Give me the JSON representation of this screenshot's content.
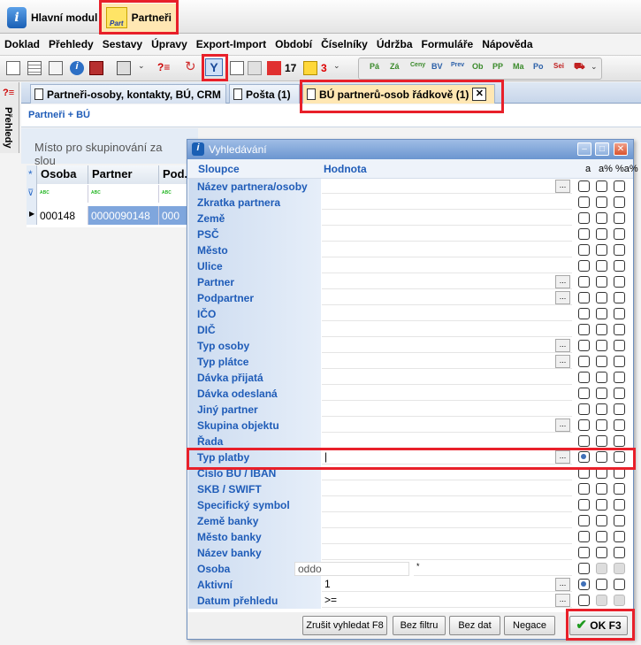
{
  "app_tabs": [
    {
      "label": "Hlavní modul",
      "icon": "info-icon"
    },
    {
      "label": "Partneři",
      "icon": "partner-icon"
    }
  ],
  "menu": [
    "Doklad",
    "Přehledy",
    "Sestavy",
    "Úpravy",
    "Export-Import",
    "Období",
    "Číselníky",
    "Údržba",
    "Formuláře",
    "Nápověda"
  ],
  "toolbar": {
    "count": "17",
    "mail_count": "3"
  },
  "side_panel": {
    "label": "Přehledy"
  },
  "doc_tabs": [
    "Partneři-osoby, kontakty, BÚ, CRM",
    "Pošta (1)",
    "BÚ partnerů-osob řádkově (1)"
  ],
  "breadcrumb": "Partneři + BÚ",
  "grouping_hint": "Místo pro skupinování za slou",
  "grid": {
    "columns": [
      "Osoba",
      "Partner",
      "Pod."
    ],
    "filter_glyph": "ᴀʙᴄ",
    "row": [
      "000148",
      "0000090148",
      "000"
    ]
  },
  "dialog": {
    "title": "Vyhledávání",
    "col_headers": {
      "field": "Sloupce",
      "value": "Hodnota",
      "a": "a",
      "a_pct": "a%",
      "pct_a_pct": "%a%"
    },
    "fields": [
      {
        "label": "Název partnera/osoby",
        "value": "",
        "dots": true
      },
      {
        "label": "Zkratka partnera",
        "value": ""
      },
      {
        "label": "Země",
        "value": ""
      },
      {
        "label": "PSČ",
        "value": ""
      },
      {
        "label": "Město",
        "value": ""
      },
      {
        "label": "Ulice",
        "value": ""
      },
      {
        "label": "Partner",
        "value": "",
        "dots": true
      },
      {
        "label": "Podpartner",
        "value": "",
        "dots": true
      },
      {
        "label": "IČO",
        "value": ""
      },
      {
        "label": "DIČ",
        "value": ""
      },
      {
        "label": "Typ osoby",
        "value": "",
        "dots": true
      },
      {
        "label": "Typ plátce",
        "value": "",
        "dots": true
      },
      {
        "label": "Dávka přijatá",
        "value": ""
      },
      {
        "label": "Dávka odeslaná",
        "value": ""
      },
      {
        "label": "Jiný partner",
        "value": ""
      },
      {
        "label": "Skupina objektu",
        "value": "",
        "dots": true
      },
      {
        "label": "Řada",
        "value": ""
      },
      {
        "label": "Typ platby",
        "value": "|",
        "dots": true,
        "a_selected": true
      },
      {
        "label": "Číslo BÚ / IBAN",
        "value": ""
      },
      {
        "label": "SKB / SWIFT",
        "value": ""
      },
      {
        "label": "Specifický symbol",
        "value": ""
      },
      {
        "label": "Země banky",
        "value": ""
      },
      {
        "label": "Město banky",
        "value": ""
      },
      {
        "label": "Název banky",
        "value": ""
      },
      {
        "label": "Osoba",
        "value": "oddo",
        "extra": "*",
        "disabled_pct": true
      },
      {
        "label": "Aktivní",
        "value": "1",
        "dots": true,
        "a_selected": true
      },
      {
        "label": "Datum přehledu",
        "value": ">=",
        "dots": true,
        "disabled_pct": true
      }
    ],
    "buttons": [
      "Zrušit vyhledat F8",
      "Bez filtru",
      "Bez dat",
      "Negace",
      "OK F3"
    ]
  }
}
